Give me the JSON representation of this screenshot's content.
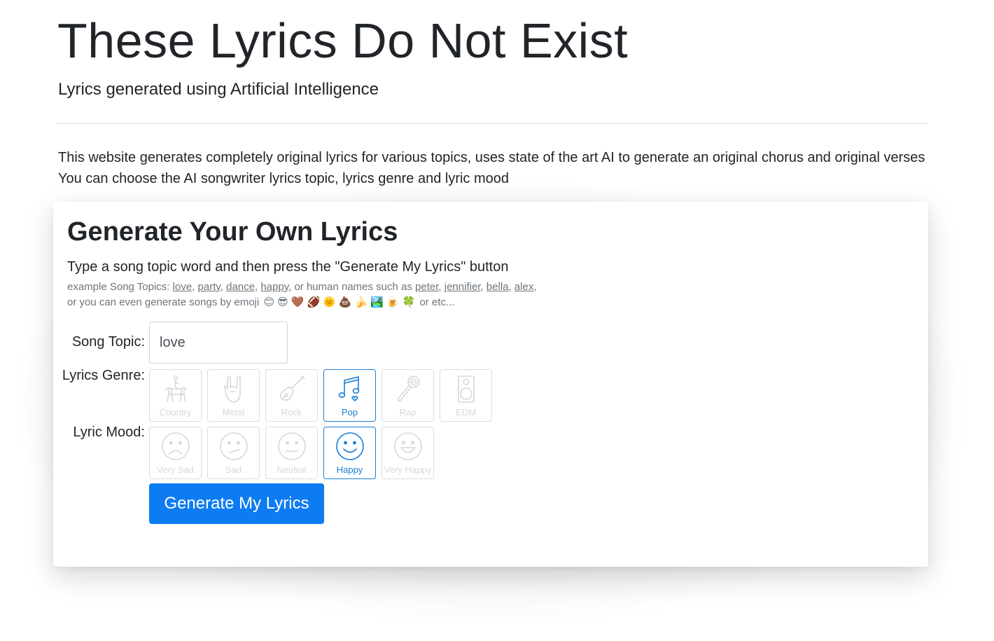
{
  "header": {
    "title": "These Lyrics Do Not Exist",
    "subtitle": "Lyrics generated using Artificial Intelligence"
  },
  "intro": {
    "line1": "This website generates completely original lyrics for various topics, uses state of the art AI to generate an original chorus and original verses",
    "line2": "You can choose the AI songwriter lyrics topic, lyrics genre and lyric mood"
  },
  "generator": {
    "title": "Generate Your Own Lyrics",
    "instruction": "Type a song topic word and then press the \"Generate My Lyrics\" button",
    "examples_prefix": "example Song Topics:",
    "example_topics": [
      "love",
      "party",
      "dance",
      "happy"
    ],
    "names_prefix": "or human names such as",
    "example_names": [
      "peter",
      "jennifier",
      "bella",
      "alex"
    ],
    "emoji_prefix": "or you can even generate songs by emoji",
    "example_emojis": [
      "😊",
      "😎",
      "🤎",
      "🏈",
      "🌞",
      "💩",
      "🍌",
      "🏞️",
      "🍺",
      "🍀"
    ],
    "emoji_suffix": "or etc...",
    "topic_label": "Song Topic:",
    "topic_value": "love",
    "genre_label": "Lyrics Genre:",
    "genres": [
      {
        "label": "Country",
        "icon": "horse-rider-icon",
        "selected": false
      },
      {
        "label": "Metal",
        "icon": "rock-hand-icon",
        "selected": false
      },
      {
        "label": "Rock",
        "icon": "electric-guitar-icon",
        "selected": false
      },
      {
        "label": "Pop",
        "icon": "music-notes-icon",
        "selected": true
      },
      {
        "label": "Rap",
        "icon": "microphone-icon",
        "selected": false
      },
      {
        "label": "EDM",
        "icon": "speaker-icon",
        "selected": false
      }
    ],
    "mood_label": "Lyric Mood:",
    "moods": [
      {
        "label": "Very Sad",
        "icon": "very-sad-face-icon",
        "selected": false
      },
      {
        "label": "Sad",
        "icon": "sad-face-icon",
        "selected": false
      },
      {
        "label": "Neutral",
        "icon": "neutral-face-icon",
        "selected": false
      },
      {
        "label": "Happy",
        "icon": "happy-face-icon",
        "selected": true
      },
      {
        "label": "Very Happy",
        "icon": "very-happy-face-icon",
        "selected": false
      }
    ],
    "button_label": "Generate My Lyrics"
  },
  "colors": {
    "accent": "#0d7cf2",
    "selected_border": "#1a7fd6",
    "muted_text": "#6c757d",
    "disabled_icon": "#d4d8dc"
  }
}
